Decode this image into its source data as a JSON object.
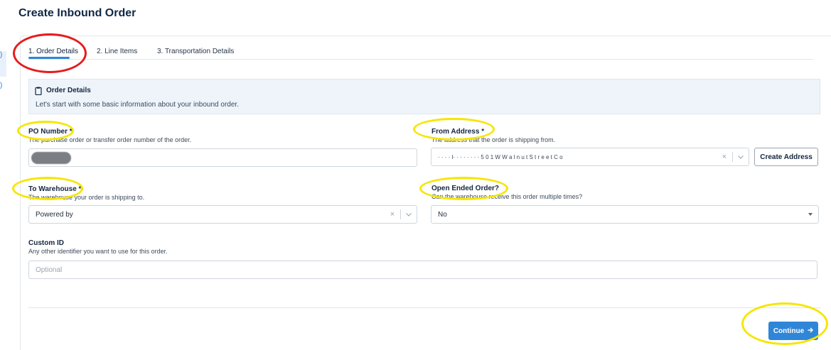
{
  "page": {
    "title": "Create Inbound Order"
  },
  "tabs": [
    {
      "label": "1. Order Details",
      "active": true
    },
    {
      "label": "2. Line Items",
      "active": false
    },
    {
      "label": "3. Transportation Details",
      "active": false
    }
  ],
  "info": {
    "icon": "clipboard-icon",
    "title": "Order Details",
    "text": "Let's start with some basic information about your inbound order."
  },
  "fields": {
    "po_number": {
      "label": "PO Number *",
      "help": "The purchase order or transfer order number of the order."
    },
    "from_address": {
      "label": "From Address *",
      "help": "The address that the order is shipping from.",
      "value": "· · · · l· · ·  · · · · ·   5 0 1 W  W a l n u t  S t r e e t  C o"
    },
    "to_warehouse": {
      "label": "To Warehouse *",
      "help": "The warehouse your order is shipping to.",
      "value": "Powered by"
    },
    "open_ended": {
      "label": "Open Ended Order?",
      "help": "Can the warehouse receive this order multiple times?",
      "value": "No"
    },
    "custom_id": {
      "label": "Custom ID",
      "help": "Any other identifier you want to use for this order.",
      "placeholder": "Optional"
    }
  },
  "buttons": {
    "create_address": "Create Address",
    "continue": "Continue",
    "clear": "×"
  },
  "colors": {
    "accent": "#2f86d8",
    "annotation_red": "#e51c1c",
    "annotation_yellow": "#f5e600"
  }
}
